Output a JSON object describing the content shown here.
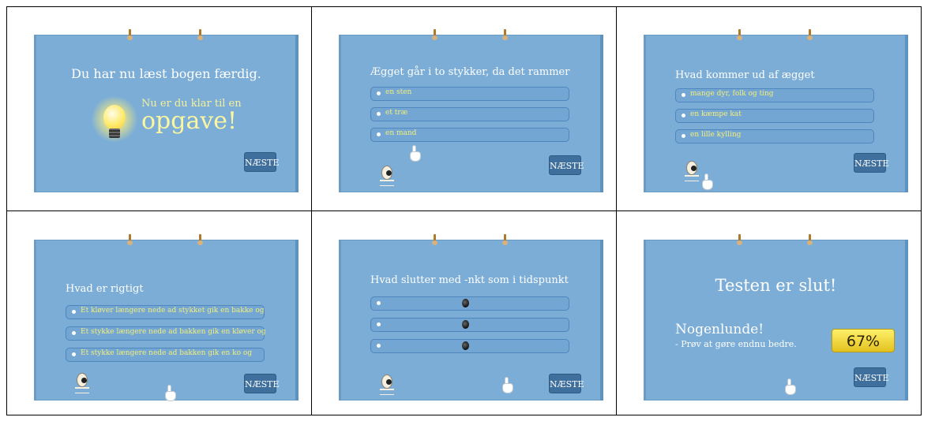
{
  "panels": [
    {
      "title": "Du har nu læst bogen færdig.",
      "subtitle": "Nu er du klar til en",
      "big": "opgave!",
      "next_label": "NÆSTE"
    },
    {
      "question": "Ægget går i to stykker, da det rammer",
      "answers": [
        "en sten",
        "et træ",
        "en mand"
      ],
      "next_label": "NÆSTE"
    },
    {
      "question": "Hvad kommer ud af ægget",
      "answers": [
        "mange dyr, folk og ting",
        "en kæmpe kat",
        "en lille kylling"
      ],
      "next_label": "NÆSTE"
    },
    {
      "question": "Hvad er rigtigt",
      "answers": [
        "Et kløver længere nede ad stykket gik en bakke og",
        "Et stykke længere nede ad bakken gik en kløver og",
        "Et stykke længere nede ad bakken gik en ko og"
      ],
      "next_label": "NÆSTE"
    },
    {
      "question": "Hvad slutter med -nkt som i tidspunkt",
      "answers": [
        "",
        "",
        ""
      ],
      "next_label": "NÆSTE"
    },
    {
      "title": "Testen er slut!",
      "result_heading": "Nogenlunde!",
      "result_text": "- Prøv at gøre endnu bedre.",
      "score": "67%",
      "next_label": "NÆSTE"
    }
  ],
  "colors": {
    "panel_bg": "#7badd6",
    "answer_text": "#f3ef7a",
    "next_button_bg": "#3f6f9c",
    "score_bg": "#f0d43a"
  }
}
